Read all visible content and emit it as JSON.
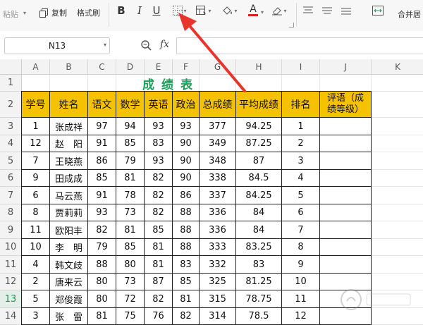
{
  "ribbon": {
    "paste": "粘贴",
    "copy": "复制",
    "format_painter": "格式刷",
    "merge_center": "合并居",
    "bold": "B",
    "italic": "I",
    "underline": "U",
    "font_color_letter": "A",
    "font_color": "#e02020"
  },
  "formula_bar": {
    "name_box": "N13",
    "fx": "fx",
    "value": ""
  },
  "columns": [
    "A",
    "B",
    "C",
    "D",
    "E",
    "F",
    "G",
    "H",
    "I",
    "J",
    "K"
  ],
  "rows": [
    "1",
    "2",
    "3",
    "4",
    "5",
    "6",
    "7",
    "8",
    "9",
    "10",
    "11",
    "12",
    "13",
    "14"
  ],
  "active_row": "13",
  "sheet": {
    "title": "成绩表",
    "headers": [
      "学号",
      "姓名",
      "语文",
      "数学",
      "英语",
      "政治",
      "总成绩",
      "平均成绩",
      "排名"
    ],
    "comment_header_line1": "评语（成",
    "comment_header_line2": "绩等级）",
    "records": [
      [
        "1",
        "张成祥",
        "97",
        "94",
        "93",
        "93",
        "377",
        "94.25",
        "1"
      ],
      [
        "12",
        "赵　阳",
        "91",
        "85",
        "83",
        "90",
        "349",
        "87.25",
        "2"
      ],
      [
        "7",
        "王晓燕",
        "86",
        "79",
        "93",
        "90",
        "348",
        "87",
        "3"
      ],
      [
        "9",
        "田成成",
        "85",
        "81",
        "82",
        "90",
        "338",
        "84.5",
        "4"
      ],
      [
        "6",
        "马云燕",
        "91",
        "78",
        "82",
        "86",
        "337",
        "84.25",
        "5"
      ],
      [
        "8",
        "贾莉莉",
        "93",
        "73",
        "82",
        "88",
        "336",
        "84",
        "6"
      ],
      [
        "11",
        "欧阳丰",
        "82",
        "81",
        "85",
        "88",
        "336",
        "84",
        "7"
      ],
      [
        "10",
        "李　明",
        "79",
        "85",
        "81",
        "88",
        "333",
        "83.25",
        "8"
      ],
      [
        "4",
        "韩文歧",
        "88",
        "80",
        "81",
        "83",
        "332",
        "83",
        "9"
      ],
      [
        "2",
        "唐来云",
        "80",
        "73",
        "87",
        "85",
        "325",
        "81.25",
        "10"
      ],
      [
        "5",
        "郑俊霞",
        "80",
        "72",
        "82",
        "81",
        "315",
        "78.75",
        "11"
      ],
      [
        "3",
        "张　雷",
        "81",
        "75",
        "76",
        "82",
        "314",
        "78.5",
        "12"
      ]
    ]
  },
  "colors": {
    "header_fill": "#f6c200",
    "title_color": "#19a05a",
    "annotation_arrow": "#e8342b"
  },
  "icons": {
    "borders": "border-grid-icon",
    "fill": "fill-bucket-icon",
    "eraser": "eraser-icon",
    "formula_zoom": "zoom-icon"
  }
}
